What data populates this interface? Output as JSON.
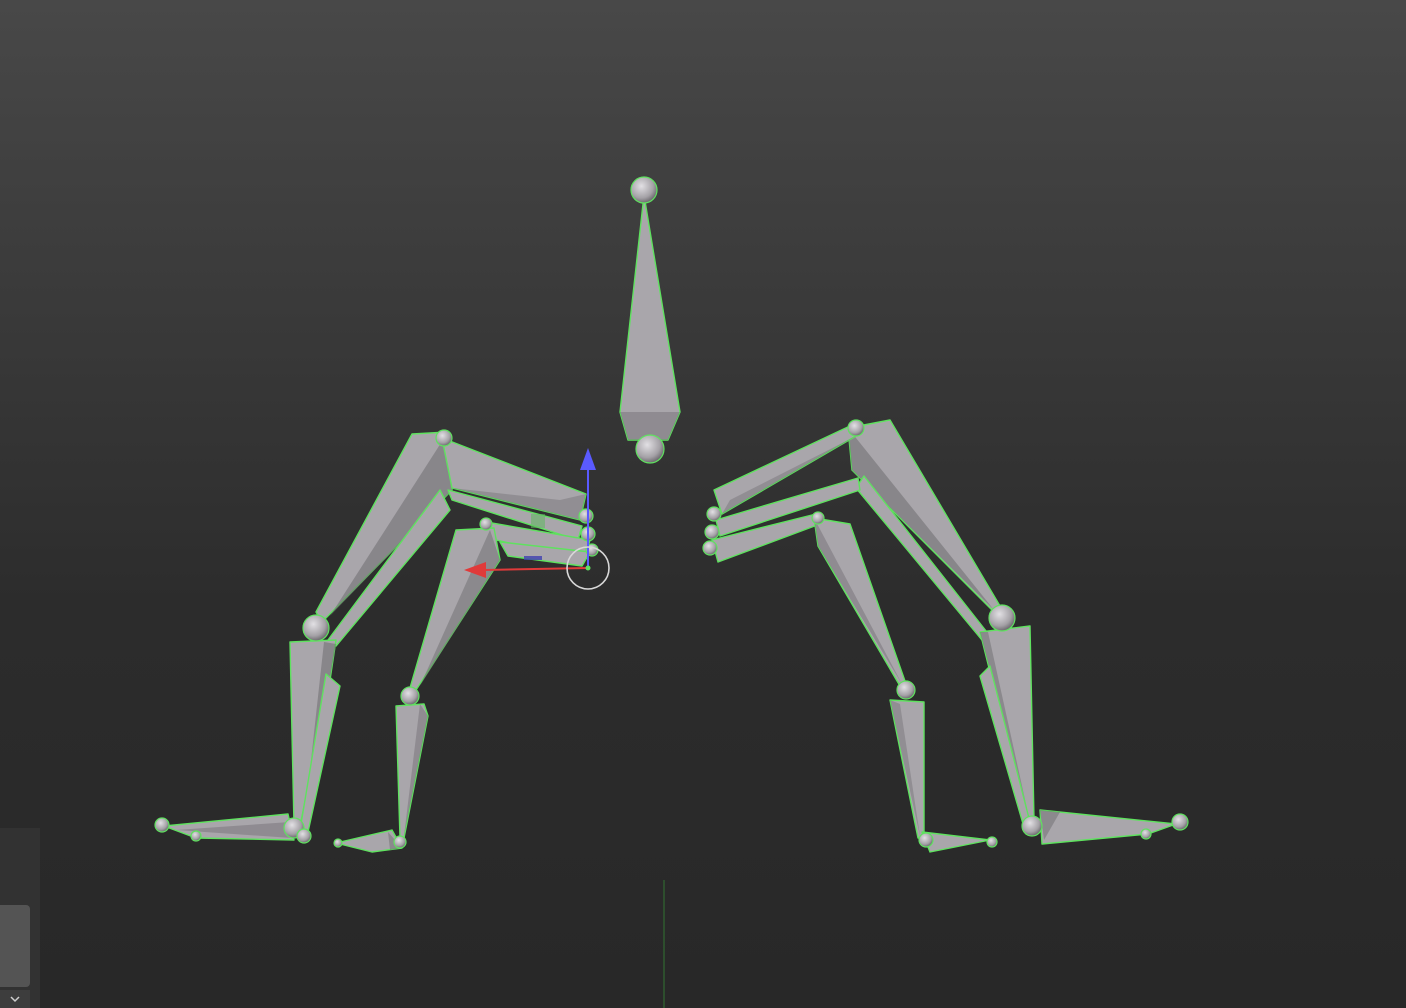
{
  "viewport": {
    "background_top": "#484848",
    "background_bottom": "#282828",
    "selection_outline_color": "#5fe25f",
    "bone_color": "#a9a6ab",
    "gizmo": {
      "x_axis_color": "#e03a3a",
      "z_axis_color": "#5a5aff",
      "y_axis_color": "#5fb85f"
    }
  },
  "side_panel": {
    "toggle_icon": "chevron-down-icon"
  }
}
